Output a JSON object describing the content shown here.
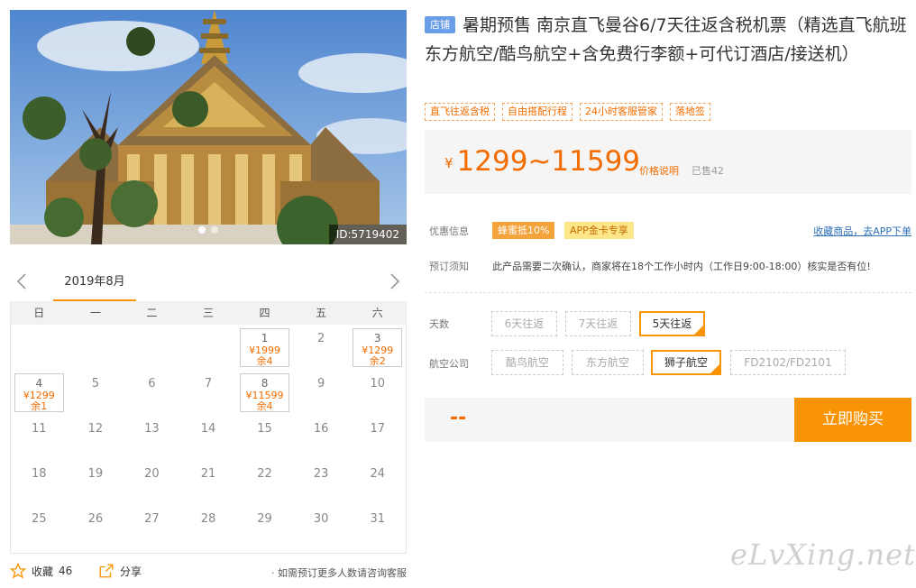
{
  "photo": {
    "id_label": "ID:5719402"
  },
  "calendar": {
    "month_label": "2019年8月",
    "weekdays": [
      "日",
      "一",
      "二",
      "三",
      "四",
      "五",
      "六"
    ],
    "cells": [
      {
        "day": ""
      },
      {
        "day": ""
      },
      {
        "day": ""
      },
      {
        "day": ""
      },
      {
        "day": "1",
        "price": "¥1999",
        "stock": "余4"
      },
      {
        "day": "2"
      },
      {
        "day": "3",
        "price": "¥1299",
        "stock": "余2"
      },
      {
        "day": "4",
        "price": "¥1299",
        "stock": "余1"
      },
      {
        "day": "5"
      },
      {
        "day": "6"
      },
      {
        "day": "7"
      },
      {
        "day": "8",
        "price": "¥11599",
        "stock": "余4"
      },
      {
        "day": "9"
      },
      {
        "day": "10"
      },
      {
        "day": "11"
      },
      {
        "day": "12"
      },
      {
        "day": "13"
      },
      {
        "day": "14"
      },
      {
        "day": "15"
      },
      {
        "day": "16"
      },
      {
        "day": "17"
      },
      {
        "day": "18"
      },
      {
        "day": "19"
      },
      {
        "day": "20"
      },
      {
        "day": "21"
      },
      {
        "day": "22"
      },
      {
        "day": "23"
      },
      {
        "day": "24"
      },
      {
        "day": "25"
      },
      {
        "day": "26"
      },
      {
        "day": "27"
      },
      {
        "day": "28"
      },
      {
        "day": "29"
      },
      {
        "day": "30"
      },
      {
        "day": "31"
      }
    ]
  },
  "actions": {
    "favorite_label": "收藏",
    "favorite_count": "46",
    "share_label": "分享",
    "note": "· 如需预订更多人数请咨询客服"
  },
  "product": {
    "shop_tag": "店铺",
    "title": "暑期预售 南京直飞曼谷6/7天往返含税机票（精选直飞航班东方航空/酷鸟航空+含免费行李额+可代订酒店/接送机）",
    "tags": [
      "直飞往返含税",
      "自由搭配行程",
      "24小时客服管家",
      "落地签"
    ]
  },
  "price": {
    "currency": "¥",
    "range": "1299~11599",
    "explain_label": "价格说明",
    "sold_label": "已售42"
  },
  "promo": {
    "label": "优惠信息",
    "badge_1": "蜂蜜抵10%",
    "badge_2": "APP金卡专享",
    "app_link": "收藏商品，去APP下单"
  },
  "booking": {
    "label": "预订须知",
    "text": "此产品需要二次确认，商家将在18个工作小时内（工作日9:00-18:00）核实是否有位!"
  },
  "options": {
    "days_label": "天数",
    "days": [
      {
        "label": "6天往返",
        "selected": false
      },
      {
        "label": "7天往返",
        "selected": false
      },
      {
        "label": "5天往返",
        "selected": true
      }
    ],
    "airline_label": "航空公司",
    "airlines": [
      {
        "label": "酷鸟航空",
        "selected": false
      },
      {
        "label": "东方航空",
        "selected": false
      },
      {
        "label": "狮子航空",
        "selected": true
      },
      {
        "label": "FD2102/FD2101",
        "selected": false
      }
    ]
  },
  "buy": {
    "price_placeholder": "--",
    "button_label": "立即购买"
  },
  "watermark": "eLvXing.net",
  "colors": {
    "accent": "#f89406",
    "price": "#f26c00",
    "link": "#2f6fb6",
    "shop_tag": "#6b9ee8"
  }
}
